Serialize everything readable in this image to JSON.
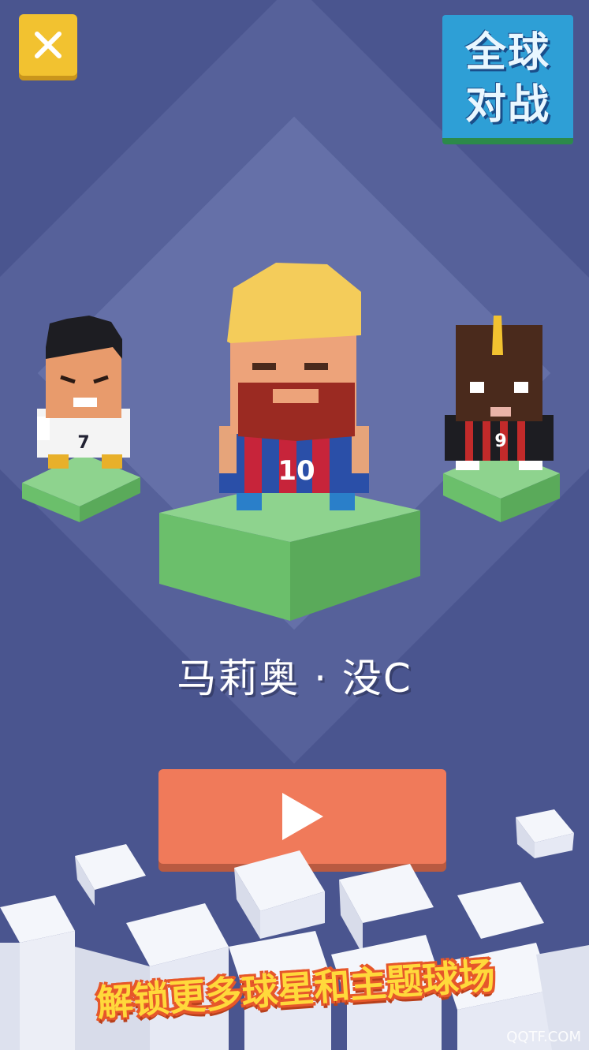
{
  "header": {
    "close_icon": "close-icon"
  },
  "logo": {
    "line1": "全球",
    "line2": "对战"
  },
  "players": [
    {
      "position": "left",
      "jersey_number": "7"
    },
    {
      "position": "center",
      "jersey_number": "10",
      "selected": true
    },
    {
      "position": "right",
      "jersey_number": "9"
    }
  ],
  "selected_player_name": "马莉奥 · 没C",
  "play_button_icon": "play-icon",
  "promo_text": "解锁更多球星和主题球场",
  "watermark": "QQTF.COM",
  "colors": {
    "background": "#4a558f",
    "close_button": "#f2c230",
    "play_button": "#f07a5a",
    "pedestal": "#7ec87e",
    "promo_text": "#ffd93b"
  }
}
